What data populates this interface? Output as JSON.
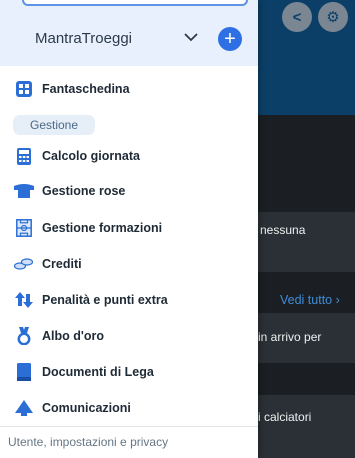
{
  "background": {
    "partial_text_1": "nessuna",
    "see_all": "Vedi tutto",
    "partial_text_2": "in arrivo per",
    "partial_text_3": "i calciatori"
  },
  "drawer": {
    "account_name": "MantraTroeggi",
    "top_item": "Fantaschedina",
    "section_label": "Gestione",
    "items": [
      {
        "label": "Calcolo giornata",
        "icon": "calculator-icon"
      },
      {
        "label": "Gestione rose",
        "icon": "jersey-icon"
      },
      {
        "label": "Gestione formazioni",
        "icon": "pitch-icon"
      },
      {
        "label": "Crediti",
        "icon": "coins-icon"
      },
      {
        "label": "Penalità e punti extra",
        "icon": "up-down-arrows-icon"
      },
      {
        "label": "Albo d'oro",
        "icon": "medal-icon"
      },
      {
        "label": "Documenti di Lega",
        "icon": "document-icon"
      },
      {
        "label": "Comunicazioni",
        "icon": "megaphone-icon"
      }
    ],
    "footer": "Utente, impostazioni e privacy"
  },
  "colors": {
    "accent": "#2f6fe4",
    "header": "#0b3f67",
    "icon_blue": "#2b6fd6"
  }
}
